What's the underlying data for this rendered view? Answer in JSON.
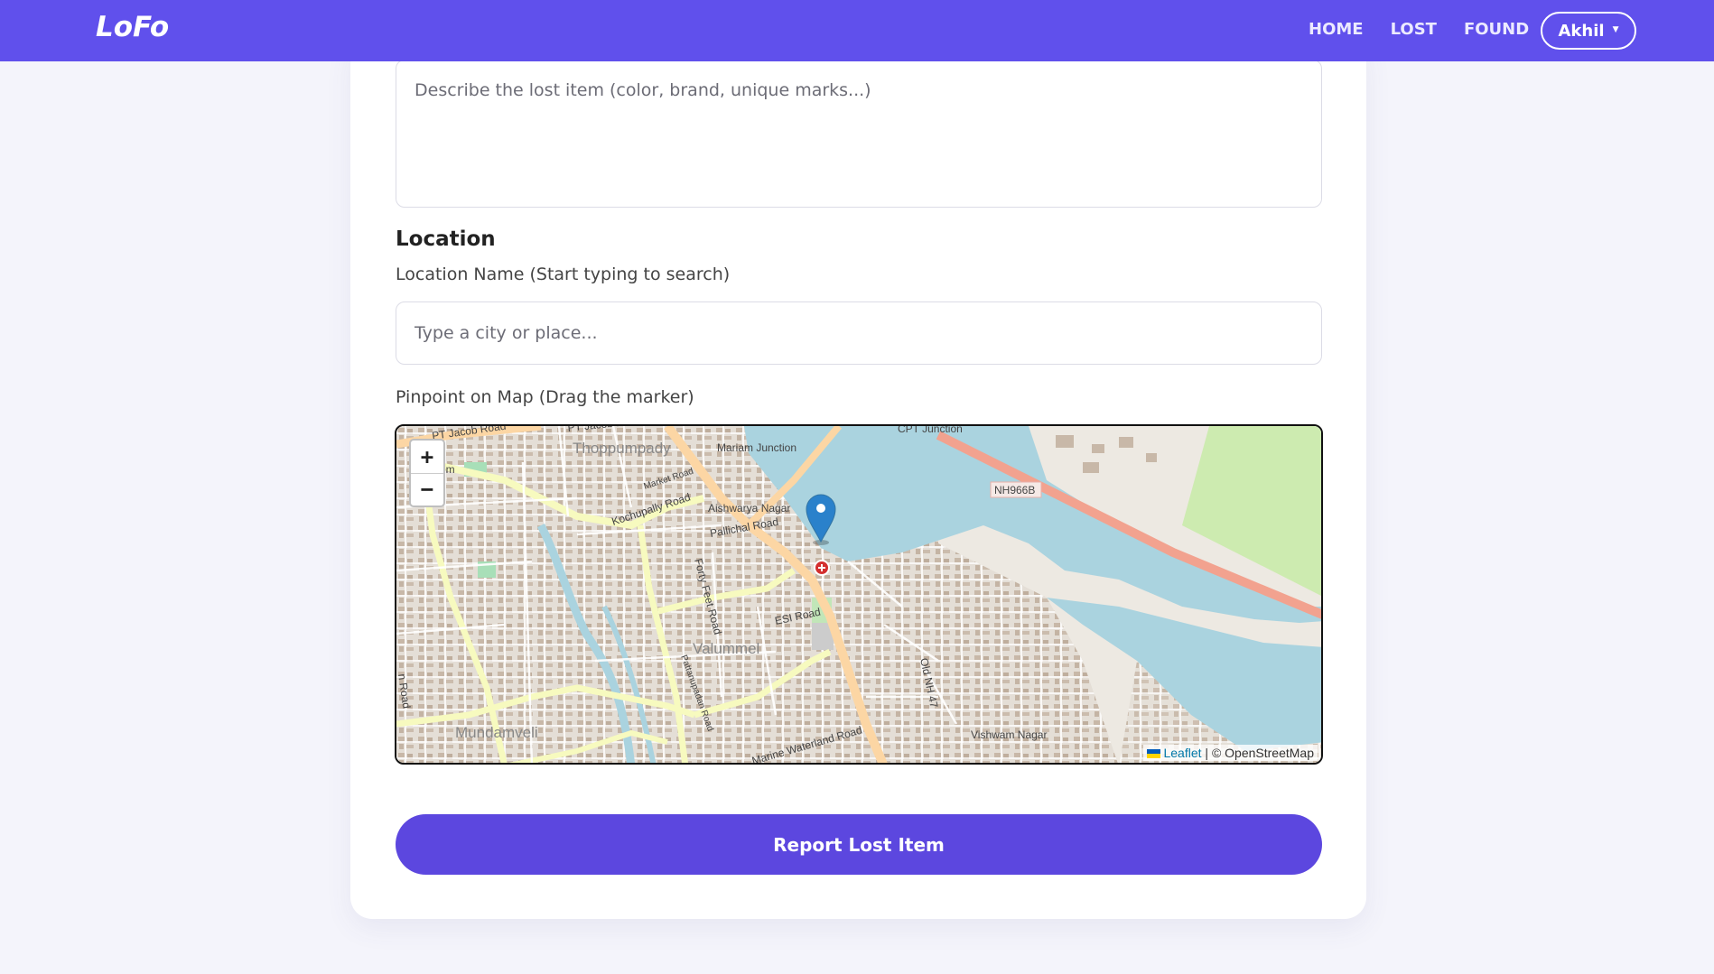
{
  "navbar": {
    "brand": "LoFo",
    "links": [
      "HOME",
      "LOST",
      "FOUND"
    ],
    "user": "Akhil"
  },
  "form": {
    "description_placeholder": "Describe the lost item (color, brand, unique marks...)",
    "location_section_title": "Location",
    "location_name_label": "Location Name (Start typing to search)",
    "location_placeholder": "Type a city or place...",
    "map_label": "Pinpoint on Map (Drag the marker)",
    "submit_label": "Report Lost Item"
  },
  "map": {
    "zoom_in": "+",
    "zoom_out": "−",
    "attribution_leaflet": "Leaflet",
    "attribution_rest": " | © OpenStreetMap",
    "labels": {
      "pt_jacob_road": "PT Jacob Road",
      "thoppumpady": "Thoppumpady",
      "mariam_junction": "Mariam Junction",
      "cpt_junction": "CPT Junction",
      "nh966b": "NH966B",
      "market_road": "Market Road",
      "kochupally_road": "Kochupally Road",
      "aishwarya_nagar": "Aishwarya Nagar",
      "pallichal_road": "Pallichal Road",
      "forty_feet_road": "Forty Feet Road",
      "esi_road": "ESI Road",
      "valummel": "Valummel",
      "pattanupadan_road": "Pattanupadan Road",
      "old_nh47": "Old NH 47",
      "mundamveli": "Mundamveli",
      "waterland_road": "Marine Waterland Road",
      "vishwam_nagar": "Vishwam Nagar",
      "road_left": "n Road",
      "left_top": "om",
      "left_top2": "y"
    },
    "colors": {
      "water": "#aad3df",
      "land": "#ede9e2",
      "major_road": "#fcd6a4",
      "highway": "#f2a28f",
      "secondary_road": "#f7fabf",
      "park": "#cdebb0",
      "marker": "#2a81cb"
    }
  },
  "colors": {
    "navbar": "#6050ec",
    "button": "#5c47df",
    "page_bg": "#f4f4fb"
  }
}
